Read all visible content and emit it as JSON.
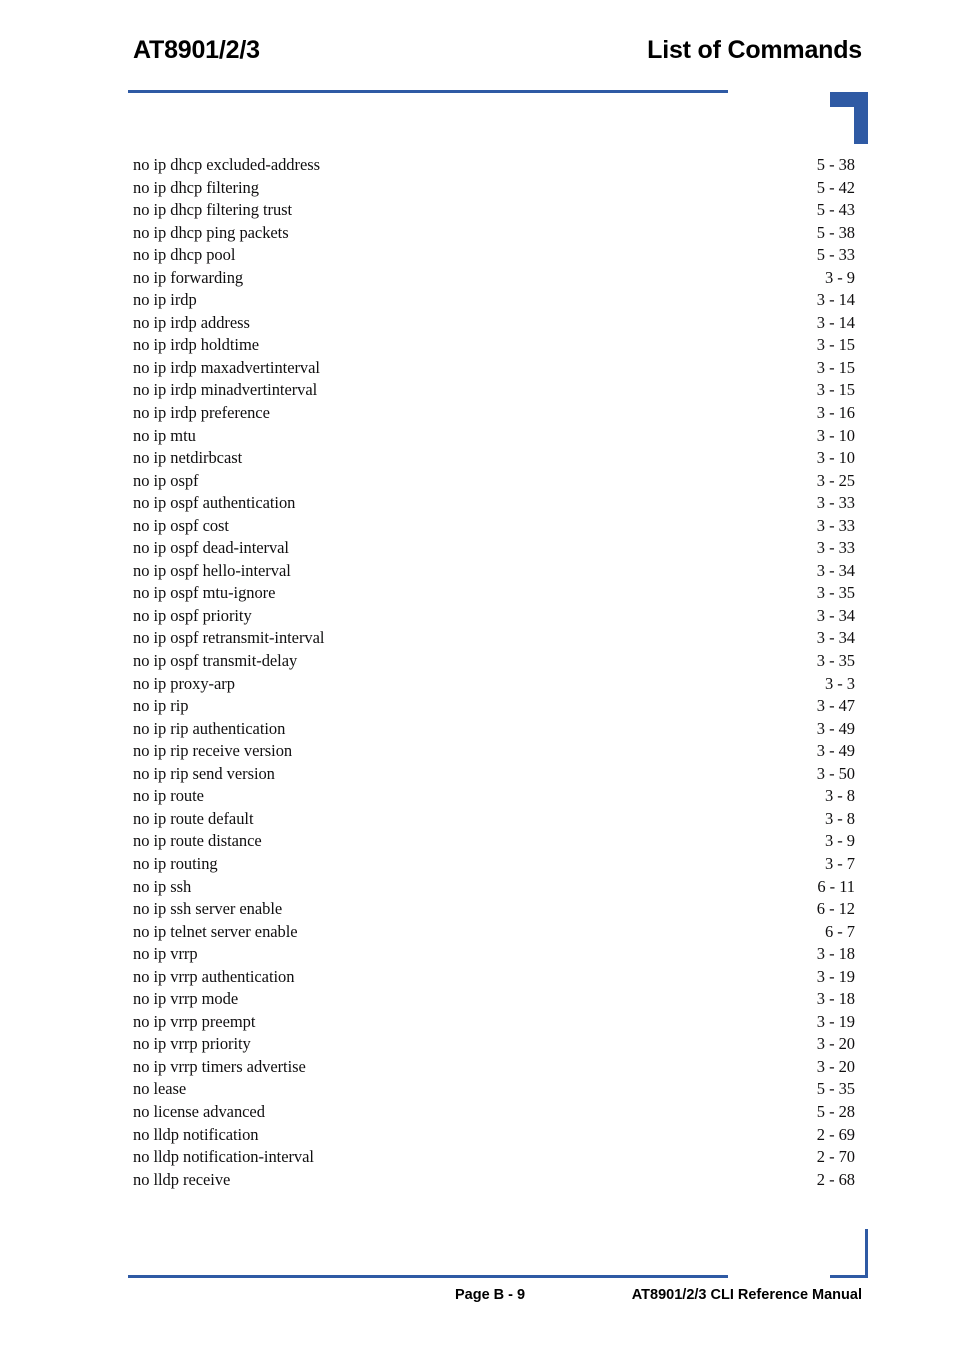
{
  "header": {
    "product_title": "AT8901/2/3",
    "section_title": "List of Commands",
    "rule_color": "#2F5AA4"
  },
  "index": {
    "entries": [
      {
        "name": "no ip dhcp excluded-address",
        "page": "5 - 38"
      },
      {
        "name": "no ip dhcp filtering",
        "page": "5 - 42"
      },
      {
        "name": "no ip dhcp filtering trust",
        "page": "5 - 43"
      },
      {
        "name": "no ip dhcp ping packets",
        "page": "5 - 38"
      },
      {
        "name": "no ip dhcp pool",
        "page": "5 - 33"
      },
      {
        "name": "no ip forwarding",
        "page": "3 - 9"
      },
      {
        "name": "no ip irdp",
        "page": "3 - 14"
      },
      {
        "name": "no ip irdp address",
        "page": "3 - 14"
      },
      {
        "name": "no ip irdp holdtime",
        "page": "3 - 15"
      },
      {
        "name": "no ip irdp maxadvertinterval",
        "page": "3 - 15"
      },
      {
        "name": "no ip irdp minadvertinterval",
        "page": "3 - 15"
      },
      {
        "name": "no ip irdp preference",
        "page": "3 - 16"
      },
      {
        "name": "no ip mtu",
        "page": "3 - 10"
      },
      {
        "name": "no ip netdirbcast",
        "page": "3 - 10"
      },
      {
        "name": "no ip ospf",
        "page": "3 - 25"
      },
      {
        "name": "no ip ospf authentication",
        "page": "3 - 33"
      },
      {
        "name": "no ip ospf cost",
        "page": "3 - 33"
      },
      {
        "name": "no ip ospf dead-interval",
        "page": "3 - 33"
      },
      {
        "name": "no ip ospf hello-interval",
        "page": "3 - 34"
      },
      {
        "name": "no ip ospf mtu-ignore",
        "page": "3 - 35"
      },
      {
        "name": "no ip ospf priority",
        "page": "3 - 34"
      },
      {
        "name": "no ip ospf retransmit-interval",
        "page": "3 - 34"
      },
      {
        "name": "no ip ospf transmit-delay",
        "page": "3 - 35"
      },
      {
        "name": "no ip proxy-arp",
        "page": "3 - 3"
      },
      {
        "name": "no ip rip",
        "page": "3 - 47"
      },
      {
        "name": "no ip rip authentication",
        "page": "3 - 49"
      },
      {
        "name": "no ip rip receive version",
        "page": "3 - 49"
      },
      {
        "name": "no ip rip send version",
        "page": "3 - 50"
      },
      {
        "name": "no ip route",
        "page": "3 - 8"
      },
      {
        "name": "no ip route default",
        "page": "3 - 8"
      },
      {
        "name": "no ip route distance",
        "page": "3 - 9"
      },
      {
        "name": "no ip routing",
        "page": "3 - 7"
      },
      {
        "name": "no ip ssh",
        "page": "6 - 11"
      },
      {
        "name": "no ip ssh server enable",
        "page": "6 - 12"
      },
      {
        "name": "no ip telnet server enable",
        "page": "6 - 7"
      },
      {
        "name": "no ip vrrp",
        "page": "3 - 18"
      },
      {
        "name": "no ip vrrp authentication",
        "page": "3 - 19"
      },
      {
        "name": "no ip vrrp mode",
        "page": "3 - 18"
      },
      {
        "name": "no ip vrrp preempt",
        "page": "3 - 19"
      },
      {
        "name": "no ip vrrp priority",
        "page": "3 - 20"
      },
      {
        "name": "no ip vrrp timers advertise",
        "page": "3 - 20"
      },
      {
        "name": "no lease",
        "page": "5 - 35"
      },
      {
        "name": "no license advanced",
        "page": "5 - 28"
      },
      {
        "name": "no lldp notification",
        "page": "2 - 69"
      },
      {
        "name": "no lldp notification-interval",
        "page": "2 - 70"
      },
      {
        "name": "no lldp receive",
        "page": "2 - 68"
      }
    ]
  },
  "footer": {
    "page_number": "Page B - 9",
    "manual_title": "AT8901/2/3 CLI Reference Manual",
    "rule_color": "#2F5AA4"
  }
}
